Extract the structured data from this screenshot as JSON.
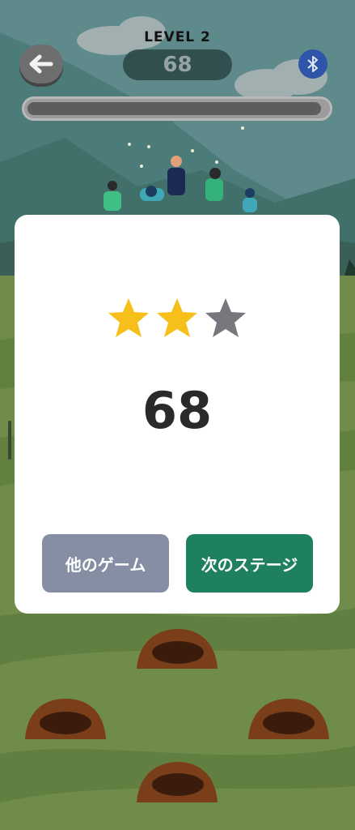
{
  "header": {
    "level_text": "LEVEL  2",
    "score": "68",
    "progress_fraction": 0.98
  },
  "result": {
    "stars_earned": 2,
    "stars_total": 3,
    "score": "68",
    "other_games_label": "他のゲーム",
    "next_stage_label": "次のステージ"
  },
  "colors": {
    "star_filled": "#f6bf1a",
    "star_empty": "#77777d",
    "next_button": "#1f8060",
    "other_button": "#868ea4"
  },
  "icons": [
    "back-arrow-icon",
    "bluetooth-icon",
    "mole-hole-icon"
  ]
}
